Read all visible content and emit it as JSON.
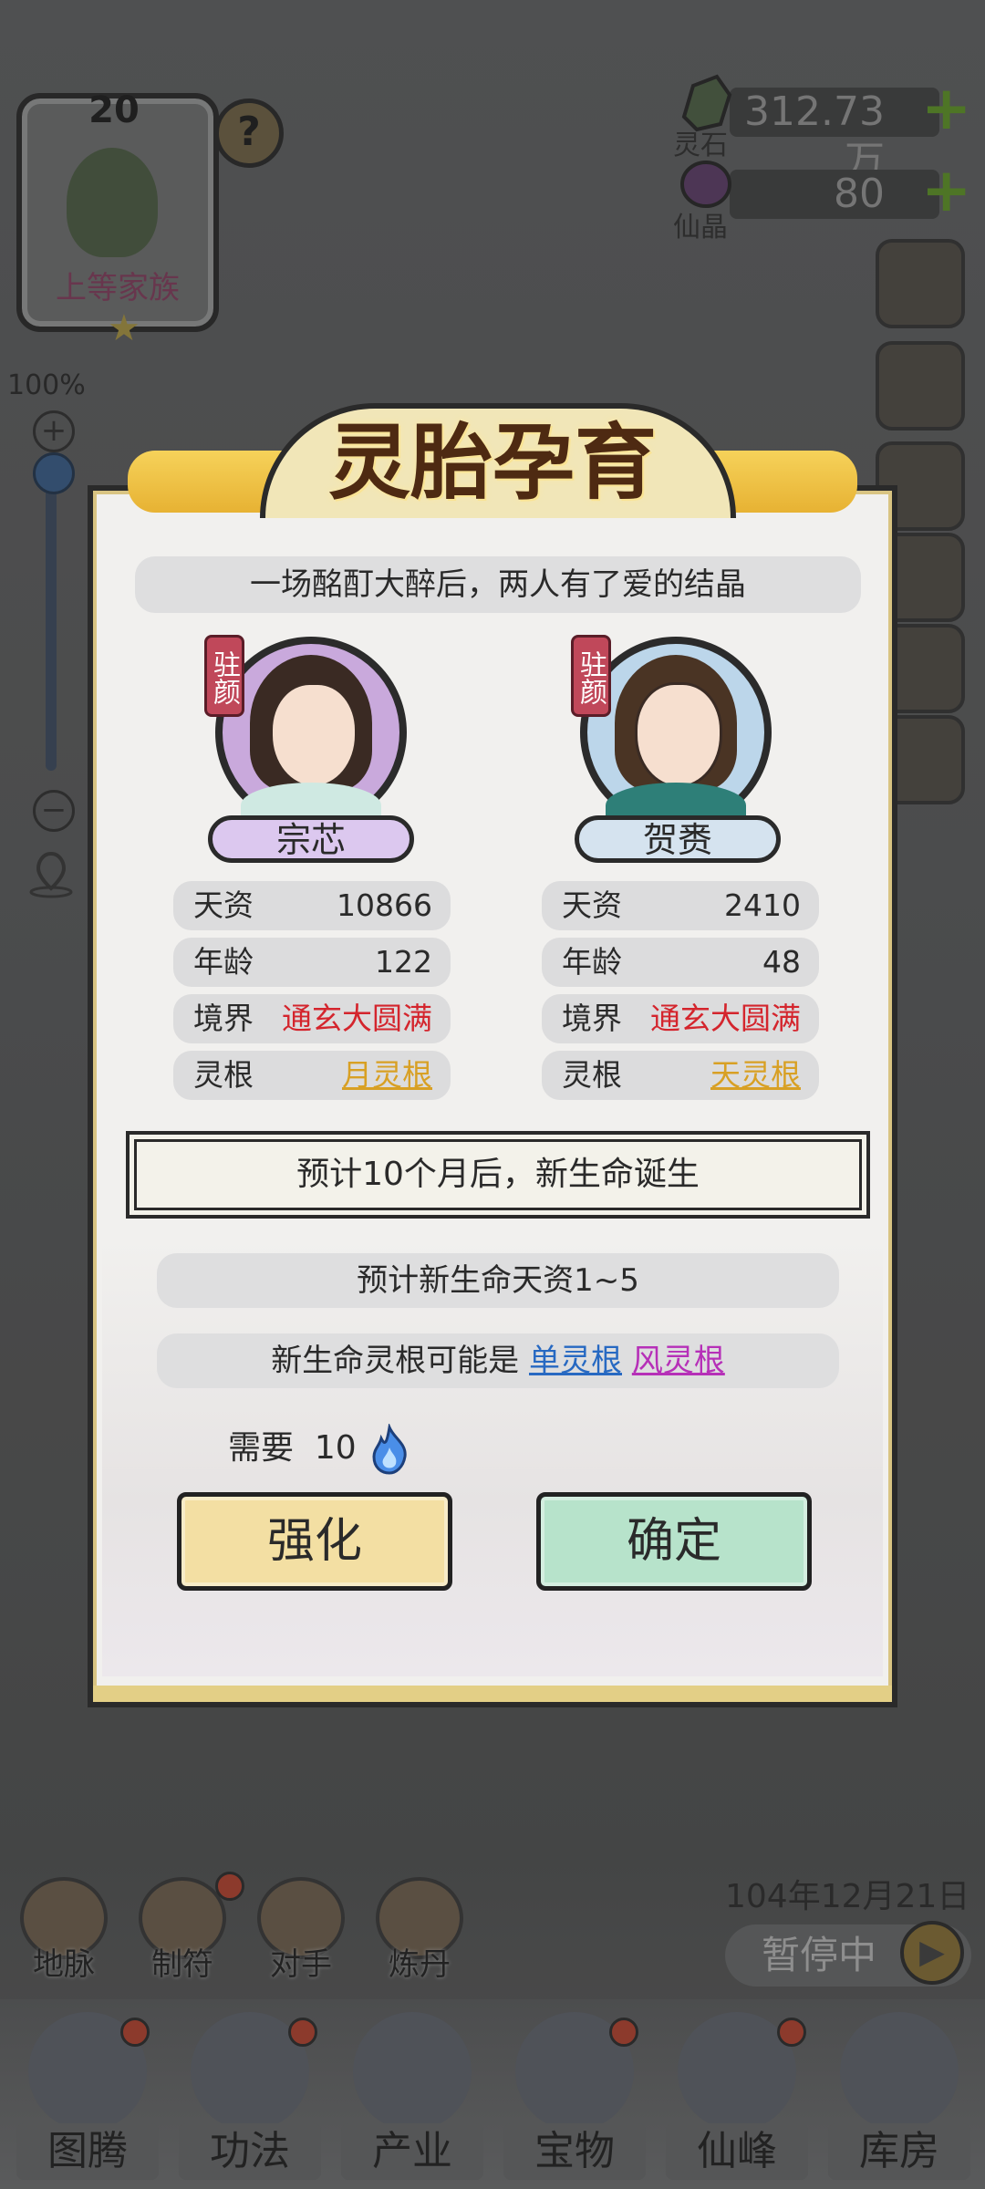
{
  "family": {
    "level": "20",
    "rank": "上等家族"
  },
  "zoom": {
    "percent": "100%",
    "value": 1.0
  },
  "currency": {
    "spirit_stone": {
      "label": "灵石",
      "amount": "312.73万"
    },
    "immortal_crystal": {
      "label": "仙晶",
      "amount": "80"
    }
  },
  "dialog": {
    "title": "灵胎孕育",
    "story": "一场酩酊大醉后，两人有了爱的结晶",
    "left": {
      "tag": "驻颜",
      "name": "宗芯",
      "stats": [
        {
          "key": "天资",
          "value": "10866",
          "style": "normal"
        },
        {
          "key": "年龄",
          "value": "122",
          "style": "normal"
        },
        {
          "key": "境界",
          "value": "通玄大圆满",
          "style": "red"
        },
        {
          "key": "灵根",
          "value": "月灵根",
          "style": "gold"
        }
      ]
    },
    "right": {
      "tag": "驻颜",
      "name": "贺赉",
      "stats": [
        {
          "key": "天资",
          "value": "2410",
          "style": "normal"
        },
        {
          "key": "年龄",
          "value": "48",
          "style": "normal"
        },
        {
          "key": "境界",
          "value": "通玄大圆满",
          "style": "red"
        },
        {
          "key": "灵根",
          "value": "天灵根",
          "style": "gold"
        }
      ]
    },
    "due_text": "预计10个月后，新生命诞生",
    "expect_text": "预计新生命天资1~5",
    "root_prefix": "新生命灵根可能是 ",
    "root_option_1": "单灵根",
    "root_option_2": "风灵根",
    "need_label": "需要",
    "need_amount": "10",
    "strengthen_label": "强化",
    "confirm_label": "确定"
  },
  "hud": {
    "date": "104年12月21日",
    "pause_label": "暂停中",
    "tools": [
      "地脉",
      "制符",
      "对手",
      "炼丹"
    ],
    "nav": [
      "图腾",
      "功法",
      "产业",
      "宝物",
      "仙峰",
      "库房"
    ]
  },
  "colors": {
    "accent_red": "#d4252d",
    "accent_gold": "#d8a024",
    "confirm_bg": "#b7e3cb",
    "strengthen_bg": "#f3dfa3"
  }
}
